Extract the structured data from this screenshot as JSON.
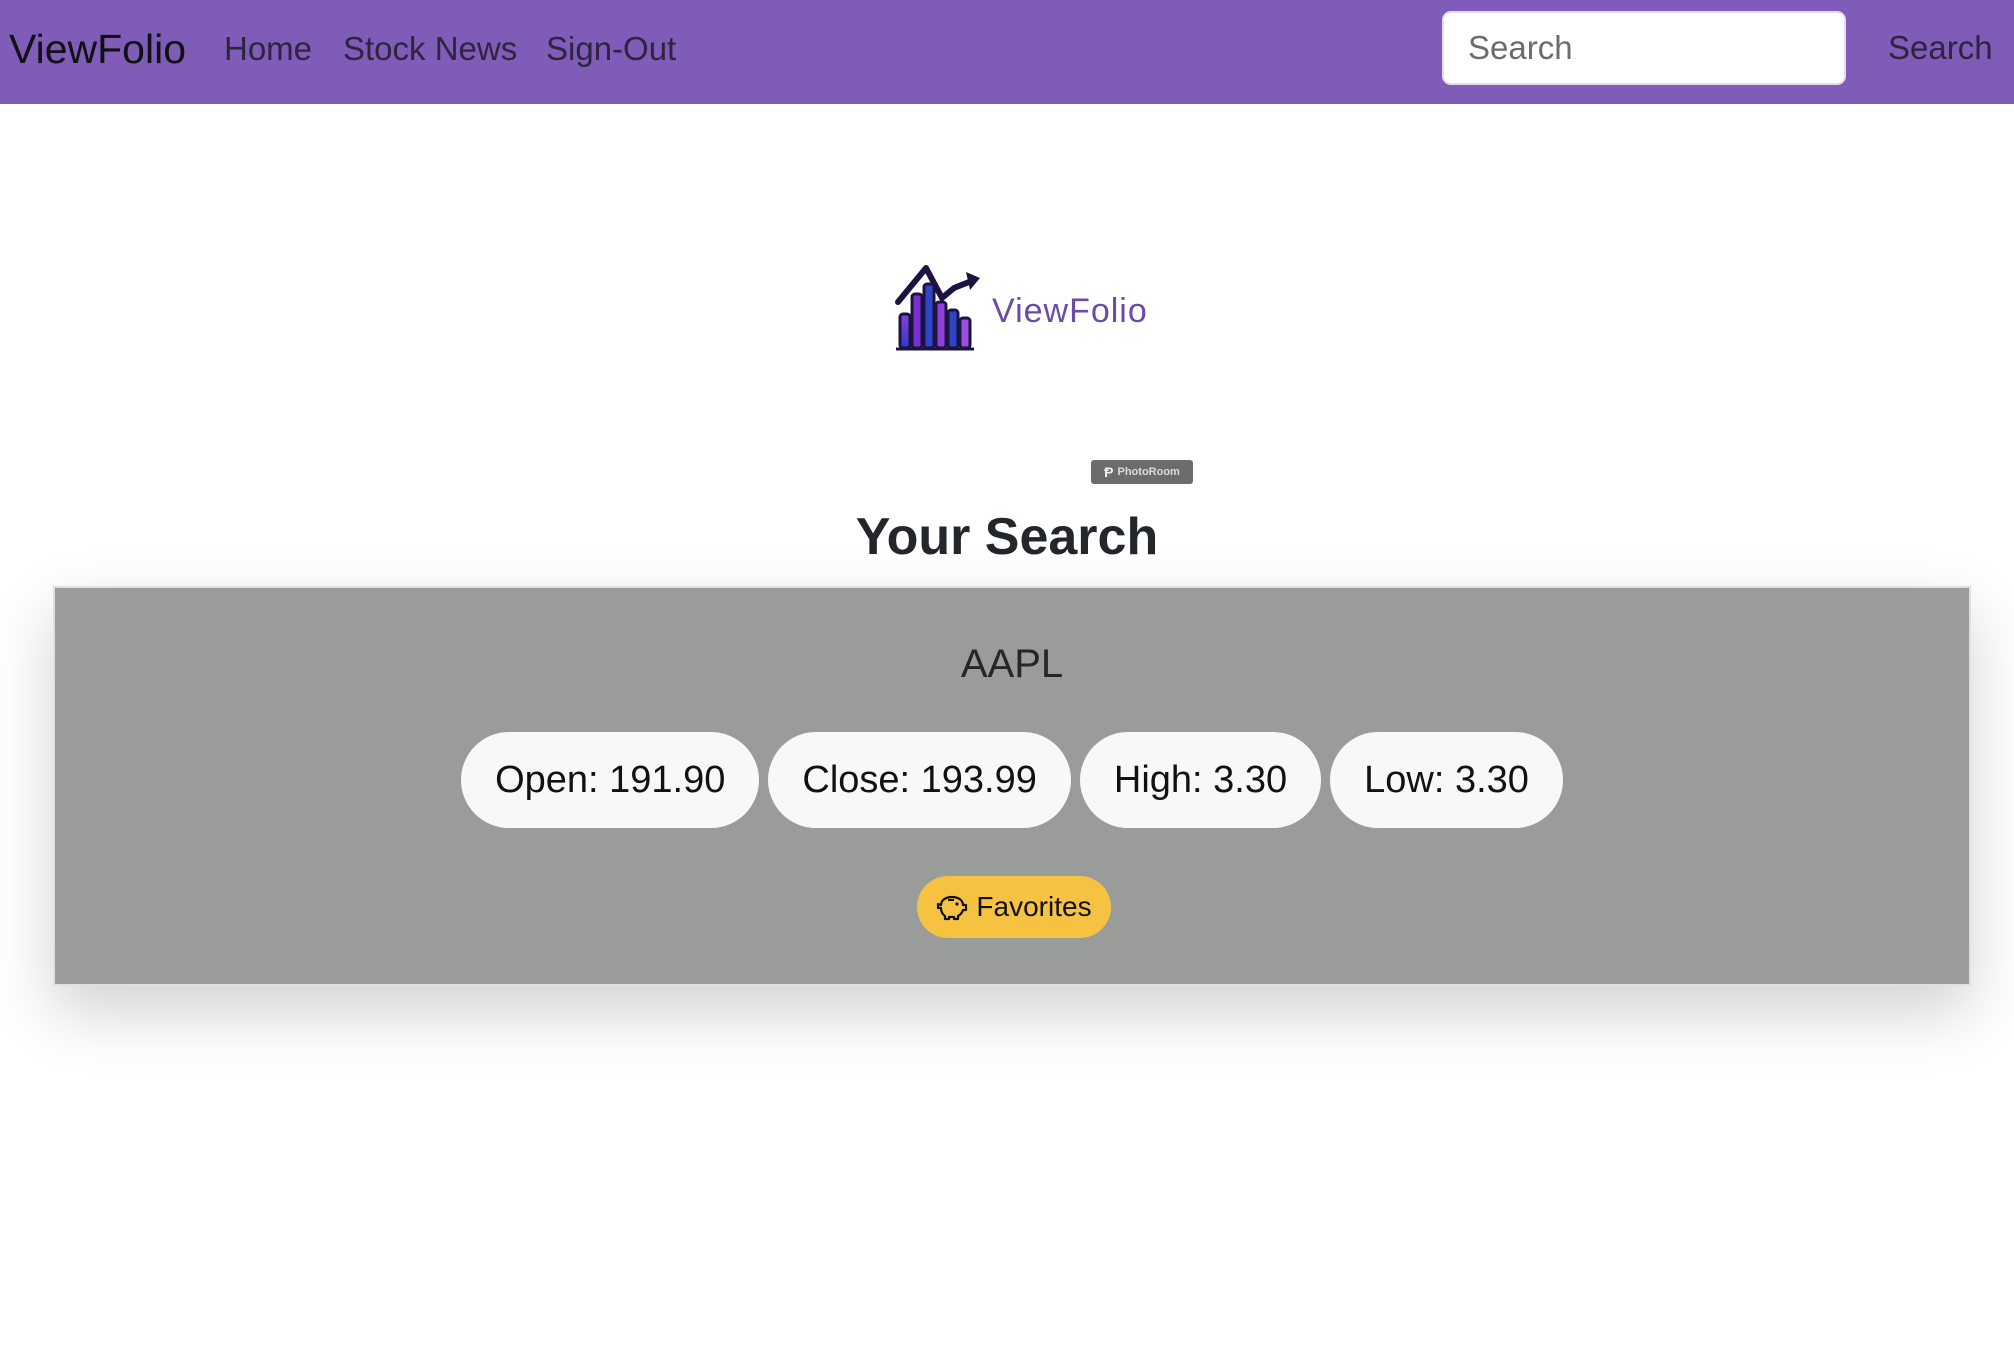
{
  "navbar": {
    "brand": "ViewFolio",
    "links": [
      "Home",
      "Stock News",
      "Sign-Out"
    ],
    "search_placeholder": "Search",
    "search_button": "Search",
    "background_color": "#7e5cb7"
  },
  "logo": {
    "text": "ViewFolio",
    "icon": "bar-chart-arrow-icon",
    "badge": "PhotoRoom"
  },
  "main": {
    "title": "Your Search"
  },
  "result": {
    "ticker": "AAPL",
    "stats": [
      "Open: 191.90",
      "Close: 193.99",
      "High: 3.30",
      "Low: 3.30"
    ],
    "favorites_label": "Favorites",
    "favorites_icon": "piggy-bank-icon",
    "card_color": "#9a9c9a",
    "favorites_color": "#f5c242"
  }
}
